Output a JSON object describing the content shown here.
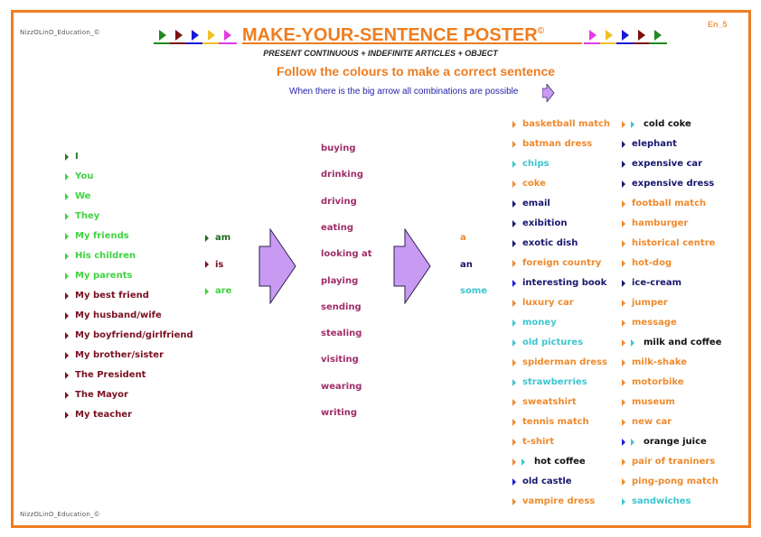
{
  "header": {
    "logo_text": "NizzOLinO_Education_©",
    "page_code": "En_5",
    "title": "MAKE-YOUR-SENTENCE POSTER",
    "copyright_mark": "©",
    "subtitle": "PRESENT CONTINUOUS + INDEFINITE ARTICLES + OBJECT",
    "instruction": "Follow the colours to make a correct sentence",
    "note": "When there is the big arrow all combinations are possible",
    "left_triangles": [
      "#1f8a1f",
      "#7a1010",
      "#1a1adb",
      "#f0c02a",
      "#e33ae3"
    ],
    "right_triangles": [
      "#e33ae3",
      "#f0c02a",
      "#1a1adb",
      "#7a1010",
      "#1f8a1f"
    ]
  },
  "colors": {
    "frame": "#ee7d22",
    "green_dark": "#1f7a2a",
    "green_light": "#3fd33f",
    "maroon": "#7a1020",
    "verb_purple": "#a02d6a",
    "orange": "#ee8a2d",
    "navy": "#17176f",
    "cyan": "#3ec6cf",
    "arrow_fill": "#c89af2"
  },
  "subjects": [
    {
      "text": "I",
      "color": "#2a7a2a"
    },
    {
      "text": "You",
      "color": "#3fd33f"
    },
    {
      "text": "We",
      "color": "#3fd33f"
    },
    {
      "text": "They",
      "color": "#3fd33f"
    },
    {
      "text": "My friends",
      "color": "#3fd33f"
    },
    {
      "text": "His children",
      "color": "#3fd33f"
    },
    {
      "text": "My parents",
      "color": "#3fd33f"
    },
    {
      "text": "My best friend",
      "color": "#7a1020"
    },
    {
      "text": "My husband/wife",
      "color": "#7a1020"
    },
    {
      "text": "My boyfriend/girlfriend",
      "color": "#7a1020"
    },
    {
      "text": "My brother/sister",
      "color": "#7a1020"
    },
    {
      "text": "The President",
      "color": "#7a1020"
    },
    {
      "text": "The Mayor",
      "color": "#7a1020"
    },
    {
      "text": "My teacher",
      "color": "#7a1020"
    }
  ],
  "auxiliaries": [
    {
      "text": "am",
      "color": "#1f6a1f"
    },
    {
      "text": "is",
      "color": "#7a1020"
    },
    {
      "text": "are",
      "color": "#3fd33f"
    }
  ],
  "verbs": [
    "buying",
    "drinking",
    "driving",
    "eating",
    "looking at",
    "playing",
    "sending",
    "stealing",
    "visiting",
    "wearing",
    "writing"
  ],
  "articles": [
    {
      "text": "a",
      "color": "#ee8a2d"
    },
    {
      "text": "an",
      "color": "#17176f"
    },
    {
      "text": "some",
      "color": "#3ec6cf"
    }
  ],
  "objects_col1": [
    {
      "text": "basketball match",
      "color": "#ee8a2d",
      "bullets": [
        "#ee8a2d"
      ]
    },
    {
      "text": "batman dress",
      "color": "#ee8a2d",
      "bullets": [
        "#ee8a2d"
      ]
    },
    {
      "text": "chips",
      "color": "#3ec6cf",
      "bullets": [
        "#3ec6cf"
      ]
    },
    {
      "text": "coke",
      "color": "#ee8a2d",
      "bullets": [
        "#ee8a2d"
      ]
    },
    {
      "text": "email",
      "color": "#17176f",
      "bullets": [
        "#17176f"
      ]
    },
    {
      "text": "exibition",
      "color": "#17176f",
      "bullets": [
        "#17176f"
      ]
    },
    {
      "text": "exotic dish",
      "color": "#17176f",
      "bullets": [
        "#17176f"
      ]
    },
    {
      "text": "foreign country",
      "color": "#ee8a2d",
      "bullets": [
        "#ee8a2d"
      ]
    },
    {
      "text": "interesting book",
      "color": "#17176f",
      "bullets": [
        "#1a1adb"
      ]
    },
    {
      "text": "luxury car",
      "color": "#ee8a2d",
      "bullets": [
        "#ee8a2d"
      ]
    },
    {
      "text": "money",
      "color": "#3ec6cf",
      "bullets": [
        "#3ec6cf"
      ]
    },
    {
      "text": "old pictures",
      "color": "#3ec6cf",
      "bullets": [
        "#3ec6cf"
      ]
    },
    {
      "text": "spiderman dress",
      "color": "#ee8a2d",
      "bullets": [
        "#ee8a2d"
      ]
    },
    {
      "text": "strawberries",
      "color": "#3ec6cf",
      "bullets": [
        "#3ec6cf"
      ]
    },
    {
      "text": "sweatshirt",
      "color": "#ee8a2d",
      "bullets": [
        "#ee8a2d"
      ]
    },
    {
      "text": "tennis match",
      "color": "#ee8a2d",
      "bullets": [
        "#ee8a2d"
      ]
    },
    {
      "text": "t-shirt",
      "color": "#ee8a2d",
      "bullets": [
        "#ee8a2d"
      ]
    },
    {
      "text": "hot coffee",
      "color": "#111111",
      "bullets": [
        "#ee8a2d",
        "#3ec6cf"
      ]
    },
    {
      "text": "old castle",
      "color": "#17176f",
      "bullets": [
        "#1a1adb"
      ]
    },
    {
      "text": "vampire dress",
      "color": "#ee8a2d",
      "bullets": [
        "#ee8a2d"
      ]
    }
  ],
  "objects_col2": [
    {
      "text": "cold coke",
      "color": "#111111",
      "bullets": [
        "#ee8a2d",
        "#3ec6cf"
      ]
    },
    {
      "text": "elephant",
      "color": "#17176f",
      "bullets": [
        "#17176f"
      ]
    },
    {
      "text": "expensive car",
      "color": "#17176f",
      "bullets": [
        "#17176f"
      ]
    },
    {
      "text": "expensive dress",
      "color": "#17176f",
      "bullets": [
        "#17176f"
      ]
    },
    {
      "text": "football match",
      "color": "#ee8a2d",
      "bullets": [
        "#ee8a2d"
      ]
    },
    {
      "text": "hamburger",
      "color": "#ee8a2d",
      "bullets": [
        "#ee8a2d"
      ]
    },
    {
      "text": "historical centre",
      "color": "#ee8a2d",
      "bullets": [
        "#ee8a2d"
      ]
    },
    {
      "text": "hot-dog",
      "color": "#ee8a2d",
      "bullets": [
        "#ee8a2d"
      ]
    },
    {
      "text": "ice-cream",
      "color": "#17176f",
      "bullets": [
        "#17176f"
      ]
    },
    {
      "text": "jumper",
      "color": "#ee8a2d",
      "bullets": [
        "#ee8a2d"
      ]
    },
    {
      "text": "message",
      "color": "#ee8a2d",
      "bullets": [
        "#ee8a2d"
      ]
    },
    {
      "text": "milk and coffee",
      "color": "#111111",
      "bullets": [
        "#ee8a2d",
        "#3ec6cf"
      ]
    },
    {
      "text": "milk-shake",
      "color": "#ee8a2d",
      "bullets": [
        "#ee8a2d"
      ]
    },
    {
      "text": "motorbike",
      "color": "#ee8a2d",
      "bullets": [
        "#ee8a2d"
      ]
    },
    {
      "text": "museum",
      "color": "#ee8a2d",
      "bullets": [
        "#ee8a2d"
      ]
    },
    {
      "text": "new car",
      "color": "#ee8a2d",
      "bullets": [
        "#ee8a2d"
      ]
    },
    {
      "text": "orange juice",
      "color": "#111111",
      "bullets": [
        "#1a1adb",
        "#3ec6cf"
      ]
    },
    {
      "text": "pair of traniners",
      "color": "#ee8a2d",
      "bullets": [
        "#ee8a2d"
      ]
    },
    {
      "text": "ping-pong match",
      "color": "#ee8a2d",
      "bullets": [
        "#ee8a2d"
      ]
    },
    {
      "text": "sandwiches",
      "color": "#3ec6cf",
      "bullets": [
        "#3ec6cf"
      ]
    }
  ]
}
